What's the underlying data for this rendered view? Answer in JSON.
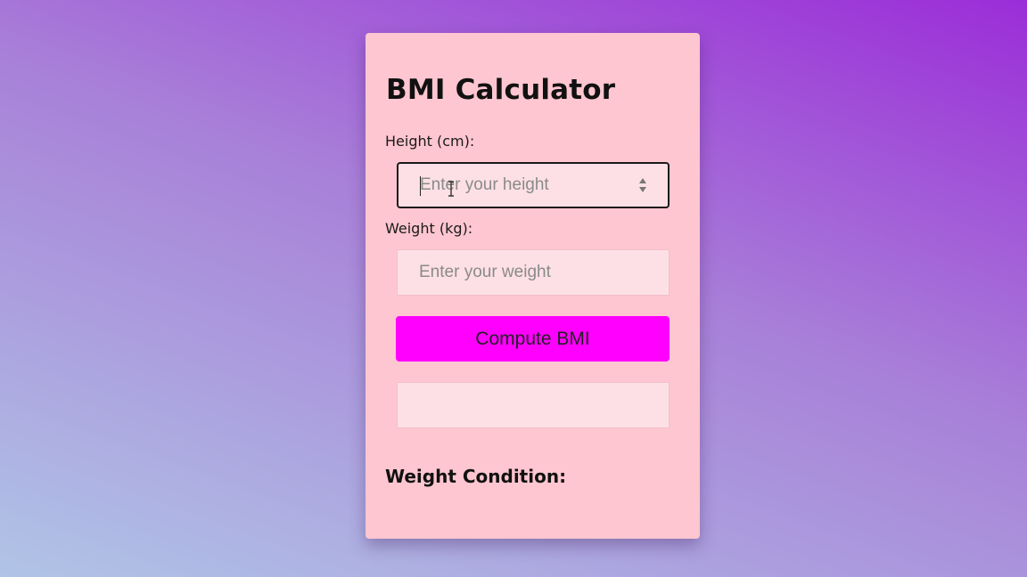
{
  "card": {
    "title": "BMI Calculator",
    "height_label": "Height (cm):",
    "height_placeholder": "Enter your height",
    "height_value": "",
    "weight_label": "Weight (kg):",
    "weight_placeholder": "Enter your weight",
    "weight_value": "",
    "compute_label": "Compute BMI",
    "result_value": "",
    "condition_label": "Weight Condition:"
  },
  "colors": {
    "card_background": "#fec6d0",
    "button_background": "#ff00ff",
    "field_background": "#fde0e6"
  },
  "icons": {
    "spinner": "number-spinner-icon",
    "cursor": "text-cursor-icon"
  }
}
